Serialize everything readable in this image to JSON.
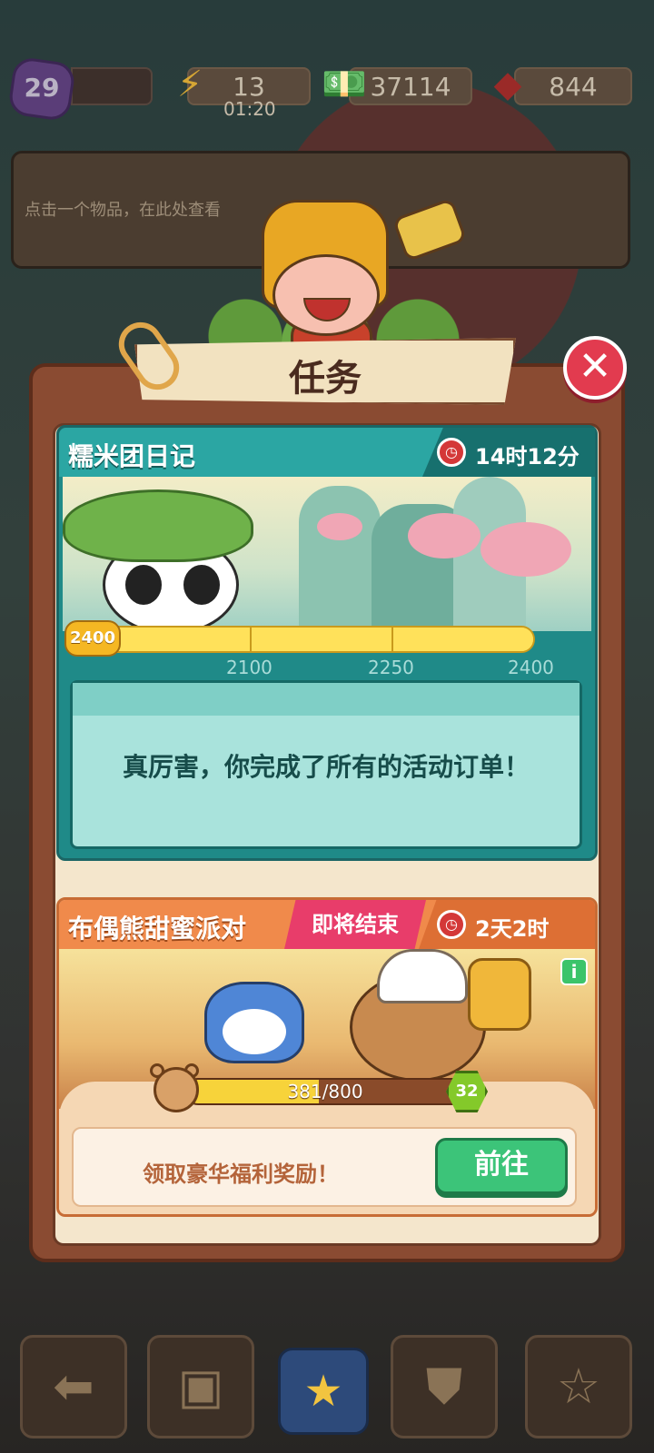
{
  "topbar": {
    "level": "29",
    "energy": "13",
    "energy_timer": "01:20",
    "cash": "37114",
    "gems": "844"
  },
  "hint": {
    "text": "点击一个物品，在此处查看"
  },
  "dialog": {
    "title": "任务",
    "close_label": "✕"
  },
  "card1": {
    "title": "糯米团日记",
    "timer": "14时12分",
    "progress_badge": "2400",
    "progress_current": 2400,
    "progress_max": 2400,
    "milestones": [
      "2100",
      "2250",
      "2400"
    ],
    "message": "真厉害，你完成了所有的活动订单！"
  },
  "card2": {
    "title": "布偶熊甜蜜派对",
    "ending_tag": "即将结束",
    "timer": "2天2时",
    "info_label": "i",
    "progress_text": "381/800",
    "progress_current": 381,
    "progress_max": 800,
    "level": "32",
    "reward_text": "领取豪华福利奖励！",
    "go_button": "前往"
  },
  "icons": {
    "energy": "⚡",
    "cash": "💵",
    "gem": "◆",
    "back": "⬅",
    "bag": "▣",
    "chest": "★",
    "basket": "⛊",
    "tasks": "☆"
  }
}
